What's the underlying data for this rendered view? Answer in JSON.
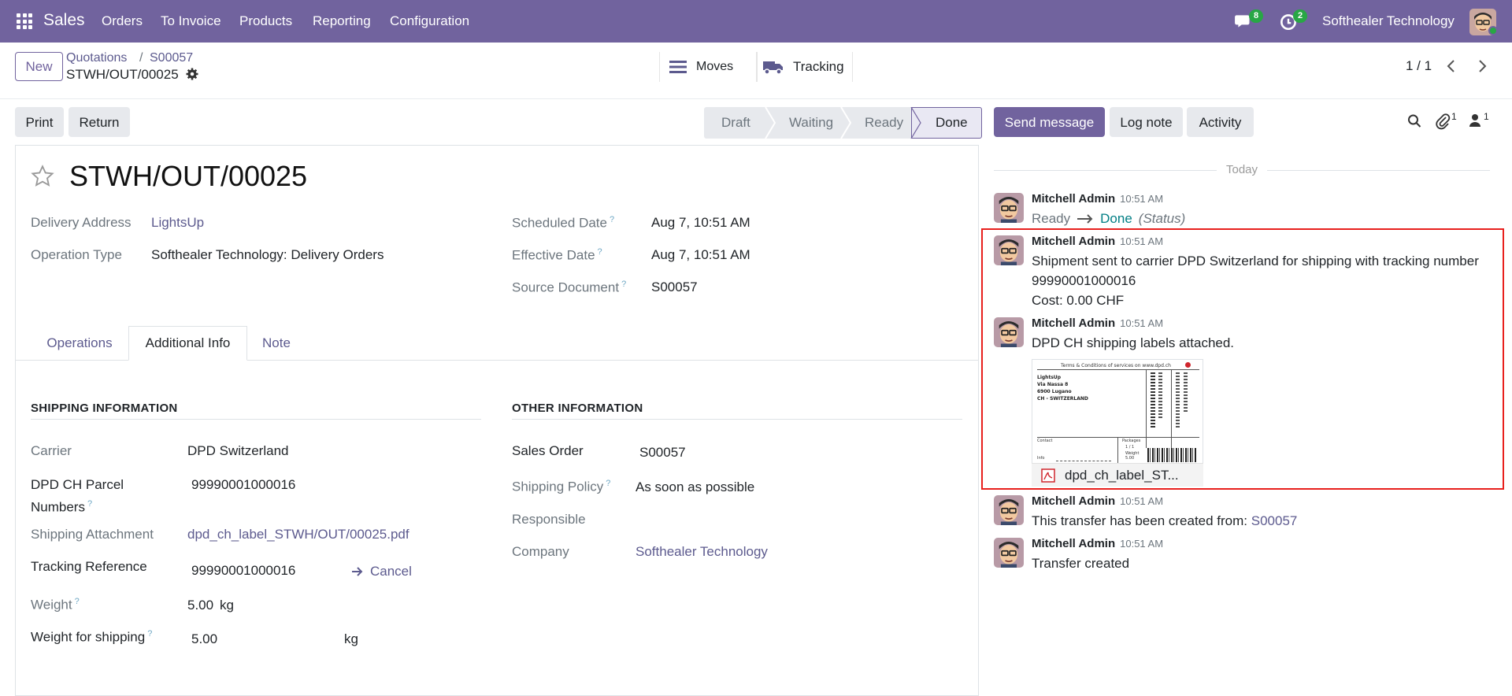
{
  "navbar": {
    "app": "Sales",
    "menu": [
      "Orders",
      "To Invoice",
      "Products",
      "Reporting",
      "Configuration"
    ],
    "messages_count": "8",
    "activities_count": "2",
    "company": "Softhealer Technology"
  },
  "control": {
    "new_label": "New",
    "breadcrumb": [
      "Quotations",
      "S00057"
    ],
    "record": "STWH/OUT/00025",
    "smart_buttons": [
      {
        "label": "Moves",
        "icon": "list-icon"
      },
      {
        "label": "Tracking",
        "icon": "truck-icon"
      }
    ],
    "pager": "1 / 1"
  },
  "actions": {
    "print": "Print",
    "return": "Return"
  },
  "stages": [
    "Draft",
    "Waiting",
    "Ready",
    "Done"
  ],
  "active_stage": "Done",
  "form": {
    "title": "STWH/OUT/00025",
    "left_fields": [
      {
        "label": "Delivery Address",
        "value": "LightsUp"
      },
      {
        "label": "Operation Type",
        "value": "Softhealer Technology: Delivery Orders"
      }
    ],
    "right_fields": [
      {
        "label": "Scheduled Date",
        "value": "Aug 7, 10:51 AM"
      },
      {
        "label": "Effective Date",
        "value": "Aug 7, 10:51 AM"
      },
      {
        "label": "Source Document",
        "value": "S00057"
      }
    ],
    "tabs": [
      "Operations",
      "Additional Info",
      "Note"
    ],
    "active_tab": "Additional Info",
    "shipping": {
      "heading": "SHIPPING INFORMATION",
      "carrier_label": "Carrier",
      "carrier": "DPD Switzerland",
      "parcel_label_1": "DPD CH Parcel",
      "parcel_label_2": "Numbers",
      "parcel": "99990001000016",
      "attachment_label": "Shipping Attachment",
      "attachment": "dpd_ch_label_STWH/OUT/00025.pdf",
      "tracking_label": "Tracking Reference",
      "tracking": "99990001000016",
      "cancel": "Cancel",
      "weight_label": "Weight",
      "weight": "5.00",
      "weight_unit": "kg",
      "weight_ship_label": "Weight for shipping",
      "weight_ship": "5.00",
      "weight_ship_unit": "kg"
    },
    "other": {
      "heading": "OTHER INFORMATION",
      "sales_order_label": "Sales Order",
      "sales_order": "S00057",
      "policy_label": "Shipping Policy",
      "policy": "As soon as possible",
      "responsible_label": "Responsible",
      "company_label": "Company",
      "company": "Softhealer Technology"
    }
  },
  "chatter": {
    "send_message": "Send message",
    "log_note": "Log note",
    "activity": "Activity",
    "attachments_count": "1",
    "followers_count": "1",
    "today": "Today",
    "messages": [
      {
        "author": "Mitchell Admin",
        "time": "10:51 AM",
        "from": "Ready",
        "to": "Done",
        "field": "(Status)"
      },
      {
        "author": "Mitchell Admin",
        "time": "10:51 AM",
        "line1": "Shipment sent to carrier DPD Switzerland for shipping with tracking number",
        "line2": "99990001000016",
        "line3": "Cost: 0.00 CHF"
      },
      {
        "author": "Mitchell Admin",
        "time": "10:51 AM",
        "text": "DPD CH shipping labels attached.",
        "attachment": "dpd_ch_label_ST..."
      },
      {
        "author": "Mitchell Admin",
        "time": "10:51 AM",
        "text": "This transfer has been created from:",
        "link": "S00057"
      },
      {
        "author": "Mitchell Admin",
        "time": "10:51 AM",
        "text": "Transfer created"
      }
    ],
    "label_preview": {
      "header": "Terms & Conditions of services on www.dpd.ch",
      "address": [
        "LightsUp",
        "Via Nassa 8",
        "6900 Lugano",
        "CH - SWITZERLAND"
      ],
      "contact": "Contact",
      "packages": "Packages",
      "count": "1 / 1",
      "weight": "Weight",
      "weight_value": "5.00",
      "info": "Info"
    }
  }
}
